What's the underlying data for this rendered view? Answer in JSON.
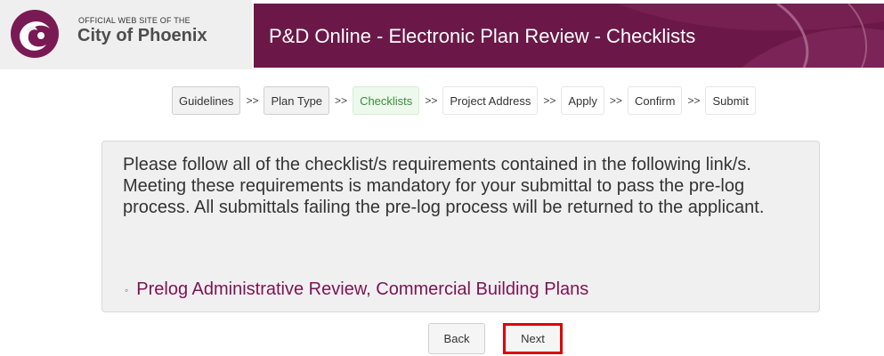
{
  "header": {
    "logo_small": "OFFICIAL WEB SITE OF THE",
    "logo_big": "City of Phoenix",
    "title": "P&D Online - Electronic Plan Review - Checklists"
  },
  "steps": [
    {
      "label": "Guidelines",
      "state": "done"
    },
    {
      "label": "Plan Type",
      "state": "done"
    },
    {
      "label": "Checklists",
      "state": "active"
    },
    {
      "label": "Project Address",
      "state": "pending"
    },
    {
      "label": "Apply",
      "state": "pending"
    },
    {
      "label": "Confirm",
      "state": "pending"
    },
    {
      "label": "Submit",
      "state": "pending"
    }
  ],
  "step_separator": ">>",
  "info": {
    "text": "Please follow all of the checklist/s requirements contained in the following link/s. Meeting these requirements is mandatory for your submittal to pass the pre-log process. All submittals failing the pre-log process will be returned to the applicant.",
    "links": [
      {
        "label": "Prelog Administrative Review, Commercial Building Plans"
      }
    ]
  },
  "buttons": {
    "back": "Back",
    "next": "Next"
  },
  "colors": {
    "brand": "#6b1848",
    "link": "#7b1454",
    "active_step": "#3c8c3c",
    "highlight": "#e00000"
  }
}
